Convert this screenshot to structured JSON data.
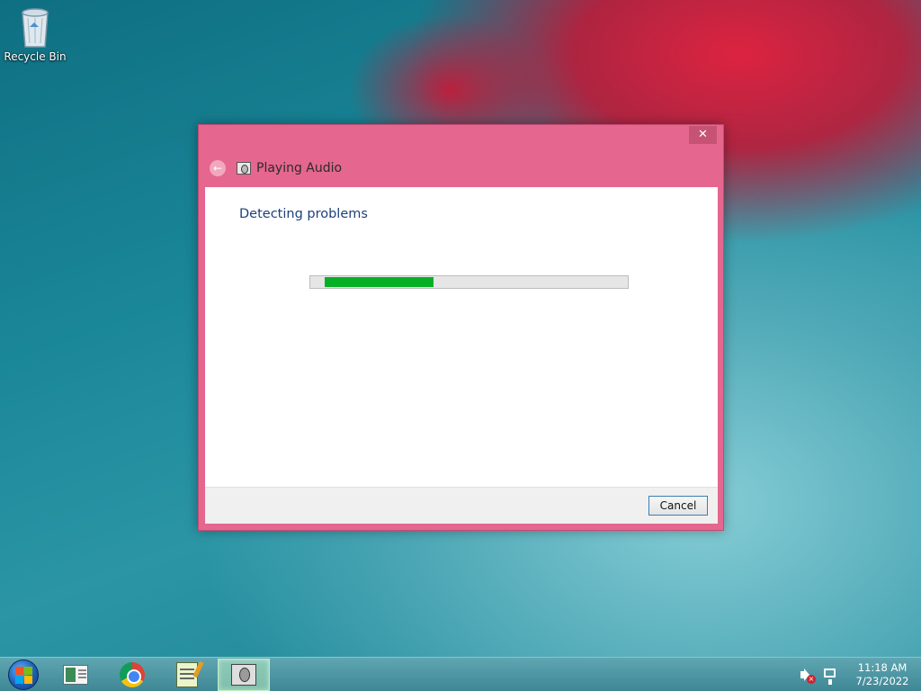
{
  "desktop": {
    "icons": [
      {
        "label": "Recycle Bin",
        "icon": "recycle-bin-icon"
      }
    ]
  },
  "dialog": {
    "close_label": "✕",
    "back_glyph": "←",
    "title": "Playing Audio",
    "heading": "Detecting problems",
    "progress_percent": 36,
    "cancel_label": "Cancel",
    "colors": {
      "frame": "#e5668f",
      "heading": "#1e3f7a",
      "progress_fill": "#06b025"
    }
  },
  "taskbar": {
    "start": {
      "icon": "windows-start-orb-icon"
    },
    "items": [
      {
        "name": "file-explorer",
        "icon": "file-explorer-icon",
        "active": false
      },
      {
        "name": "google-chrome",
        "icon": "chrome-icon",
        "active": false
      },
      {
        "name": "notepad",
        "icon": "notepad-icon",
        "active": false
      },
      {
        "name": "troubleshooter",
        "icon": "troubleshooter-icon",
        "active": true
      }
    ],
    "tray": {
      "volume_icon": "volume-muted-icon",
      "network_icon": "network-icon",
      "time": "11:18 AM",
      "date": "7/23/2022"
    }
  }
}
